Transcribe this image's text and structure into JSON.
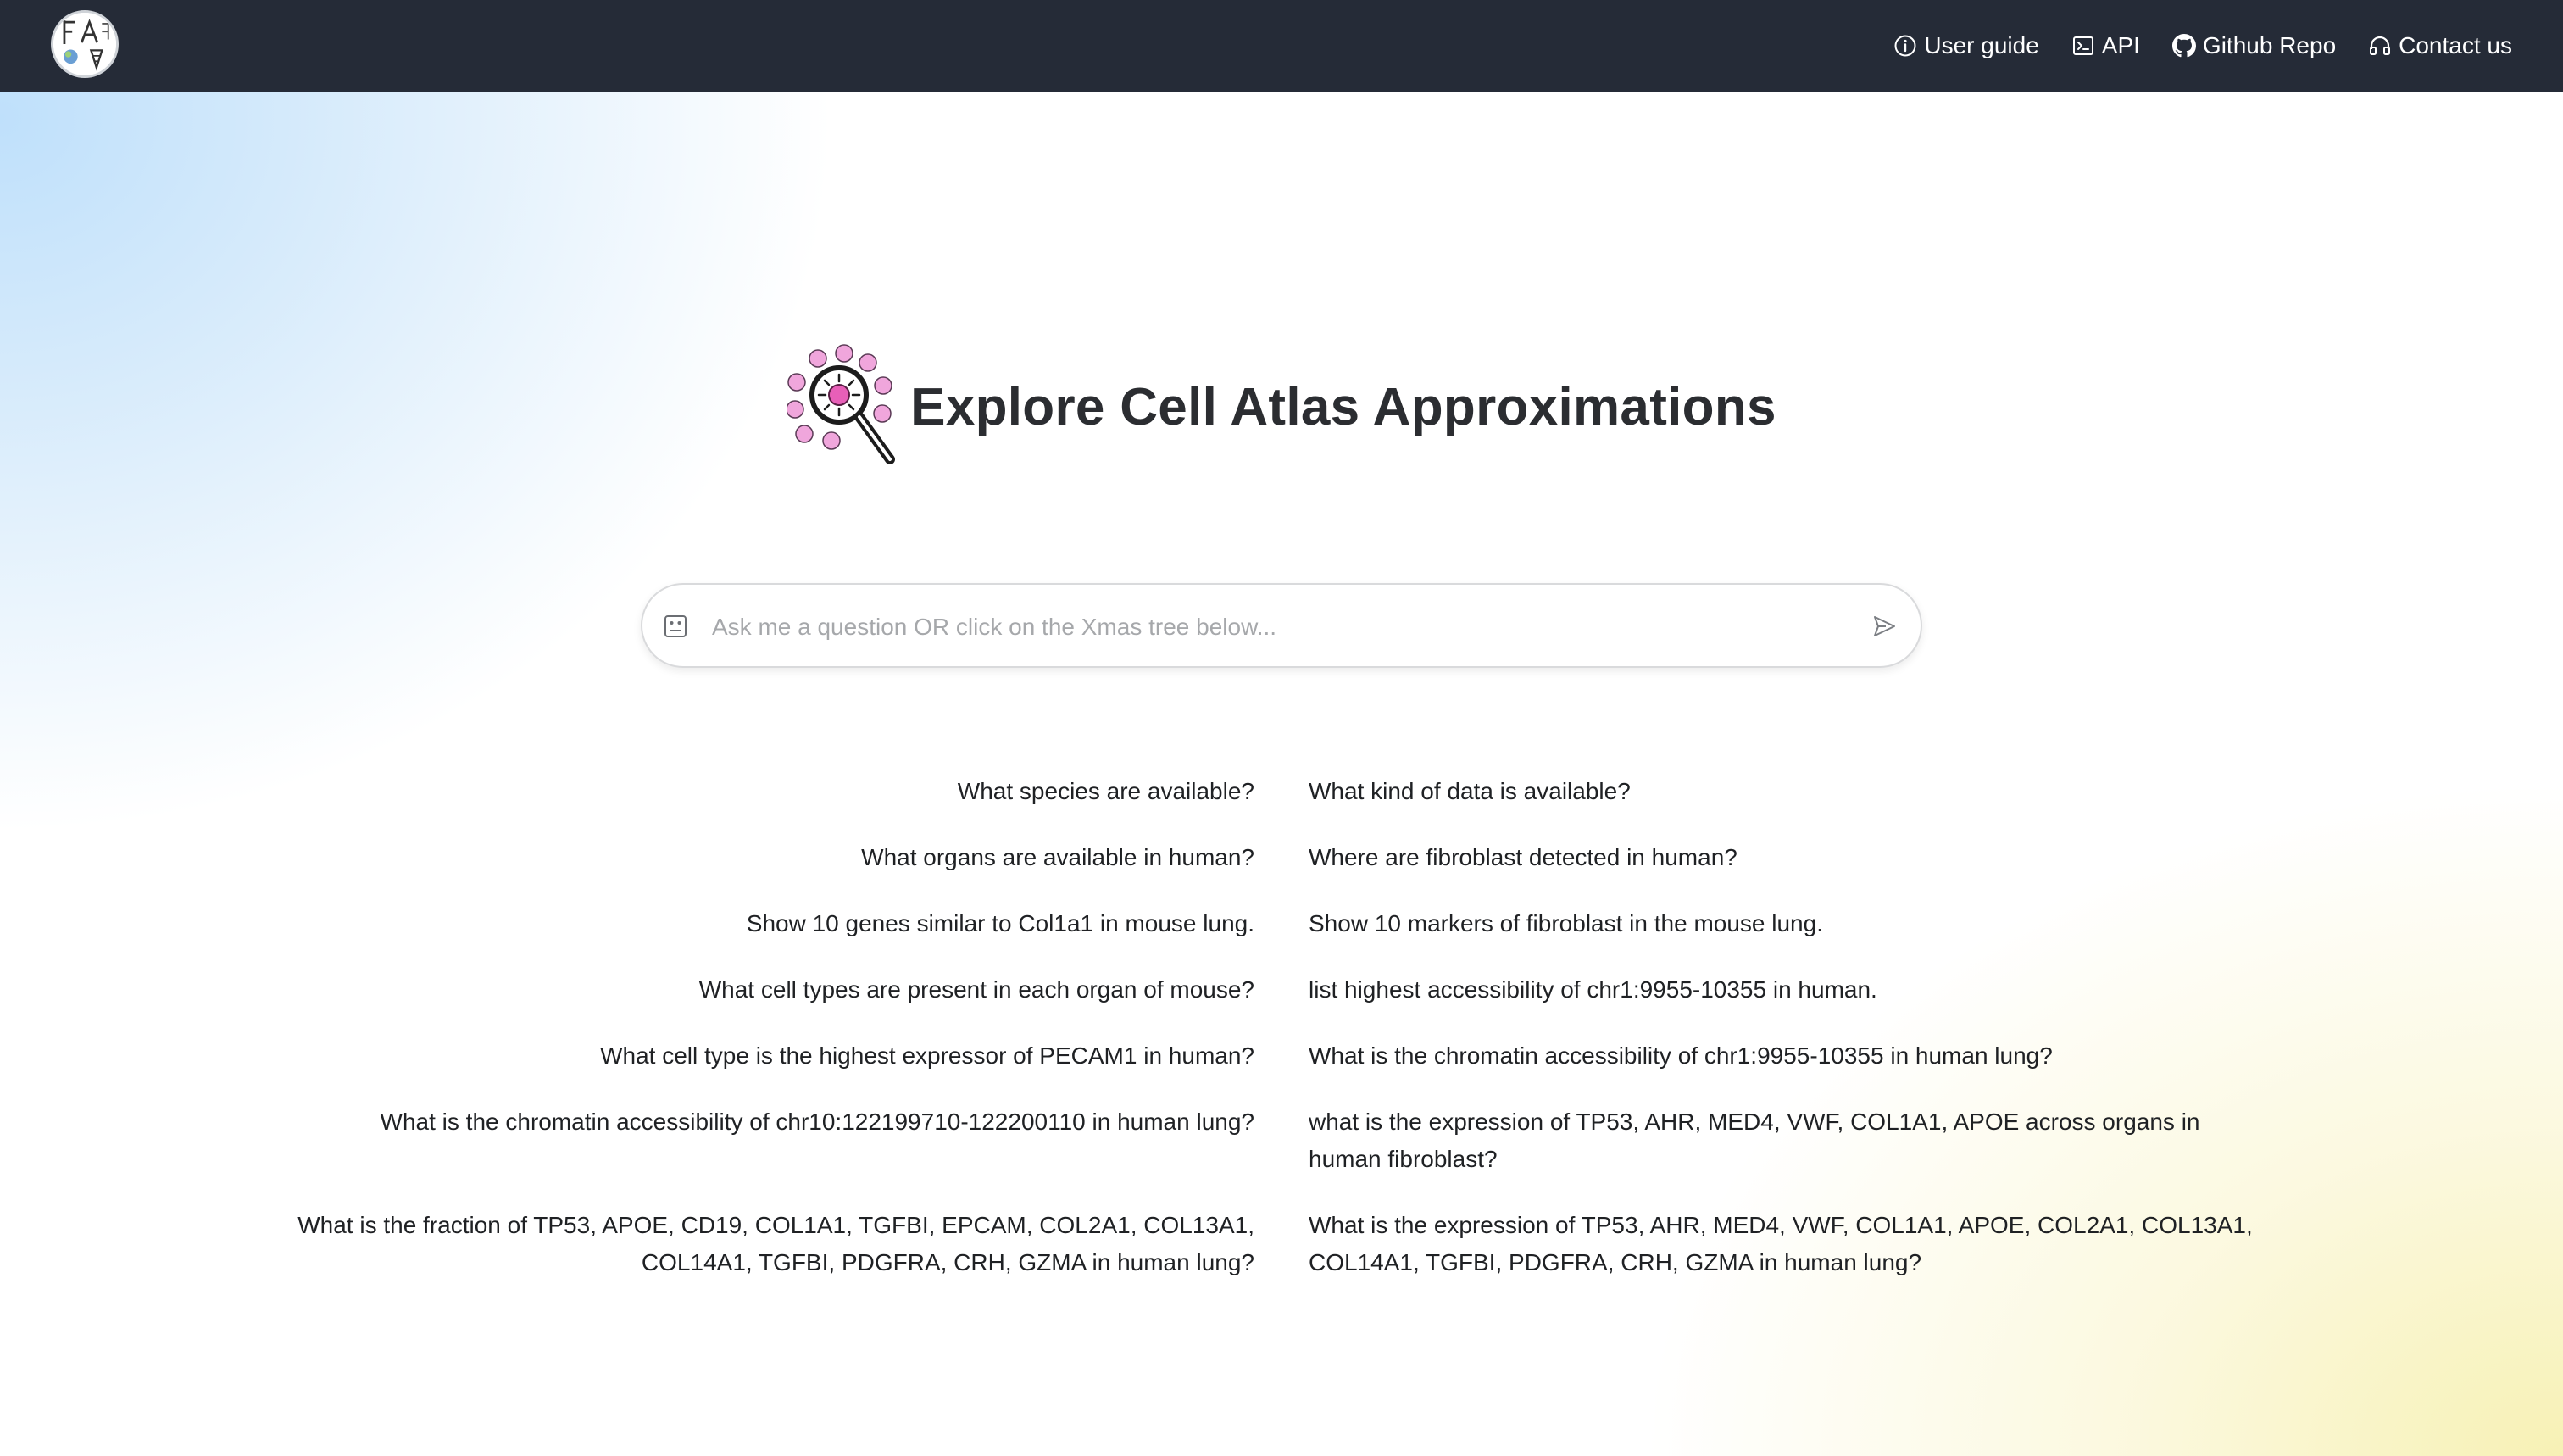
{
  "nav": {
    "links": [
      {
        "label": "User guide",
        "icon": "info-circle-icon"
      },
      {
        "label": "API",
        "icon": "terminal-icon"
      },
      {
        "label": "Github Repo",
        "icon": "github-icon"
      },
      {
        "label": "Contact us",
        "icon": "headphones-icon"
      }
    ]
  },
  "hero": {
    "title": "Explore Cell Atlas Approximations"
  },
  "search": {
    "placeholder": "Ask me a question OR click on the Xmas tree below..."
  },
  "examples": {
    "left": [
      "What species are available?",
      "What organs are available in human?",
      "Show 10 genes similar to Col1a1 in mouse lung.",
      "What cell types are present in each organ of mouse?",
      "What cell type is the highest expressor of PECAM1 in human?",
      "What is the chromatin accessibility of chr10:122199710-122200110 in human lung?",
      "What is the fraction of TP53, APOE, CD19, COL1A1, TGFBI, EPCAM, COL2A1, COL13A1, COL14A1, TGFBI, PDGFRA, CRH, GZMA in human lung?"
    ],
    "right": [
      "What kind of data is available?",
      "Where are fibroblast detected in human?",
      "Show 10 markers of fibroblast in the mouse lung.",
      "list highest accessibility of chr1:9955-10355 in human.",
      "What is the chromatin accessibility of chr1:9955-10355 in human lung?",
      "what is the expression of TP53, AHR, MED4, VWF, COL1A1, APOE across organs in human fibroblast?",
      "What is the expression of TP53, AHR, MED4, VWF, COL1A1, APOE, COL2A1, COL13A1, COL14A1, TGFBI, PDGFRA, CRH, GZMA in human lung?"
    ]
  },
  "colors": {
    "navbar": "#252b37",
    "title": "#2b2d31",
    "cell_pink": "#f0a6dc",
    "cell_center": "#e85fb8"
  }
}
